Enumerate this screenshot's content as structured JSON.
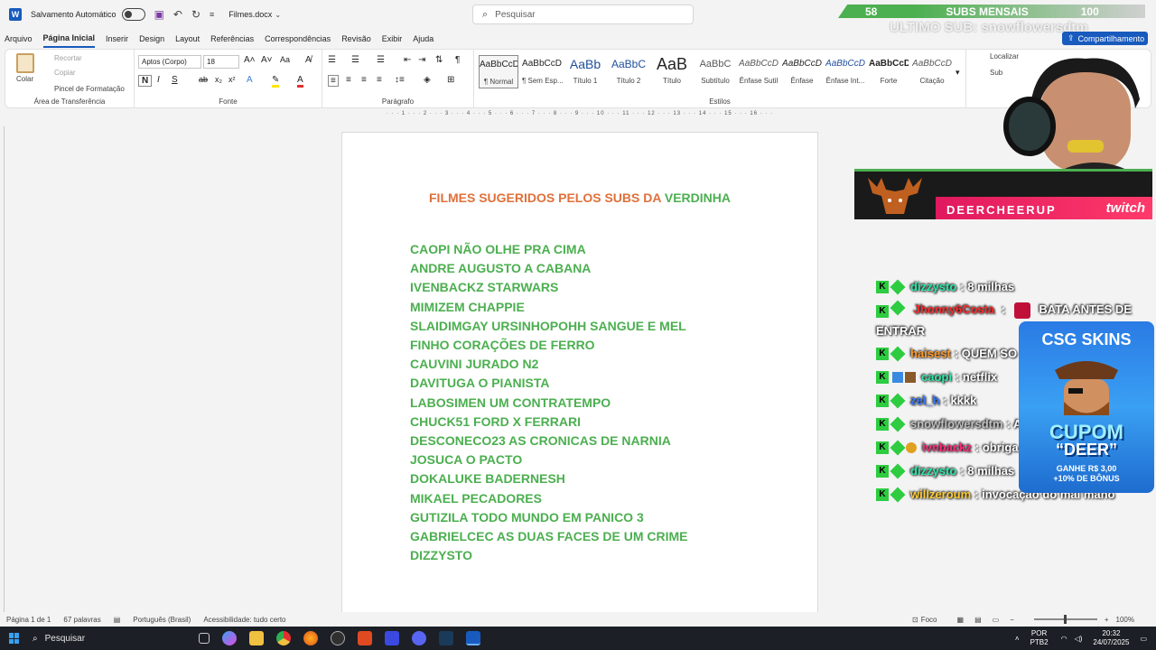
{
  "titlebar": {
    "autosave_label": "Salvamento Automático",
    "filename": "Filmes.docx",
    "search_placeholder": "Pesquisar"
  },
  "menu": {
    "tabs": [
      "Arquivo",
      "Página Inicial",
      "Inserir",
      "Design",
      "Layout",
      "Referências",
      "Correspondências",
      "Revisão",
      "Exibir",
      "Ajuda"
    ],
    "active_tab": "Página Inicial",
    "share_label": "Compartilhamento"
  },
  "ribbon": {
    "clipboard": {
      "paste": "Colar",
      "cut": "Recortar",
      "copy": "Copiar",
      "format_painter": "Pincel de Formatação",
      "group_label": "Área de Transferência"
    },
    "font": {
      "font_name": "Aptos (Corpo)",
      "font_size": "18",
      "group_label": "Fonte"
    },
    "paragraph": {
      "group_label": "Parágrafo"
    },
    "styles": {
      "group_label": "Estilos",
      "items": [
        {
          "sample": "AaBbCcD",
          "name": "¶ Normal"
        },
        {
          "sample": "AaBbCcD",
          "name": "¶ Sem Esp..."
        },
        {
          "sample": "AaBb",
          "name": "Título 1"
        },
        {
          "sample": "AaBbC",
          "name": "Título 2"
        },
        {
          "sample": "AaB",
          "name": "Título"
        },
        {
          "sample": "AaBbC",
          "name": "Subtítulo"
        },
        {
          "sample": "AaBbCcD",
          "name": "Ênfase Sutil"
        },
        {
          "sample": "AaBbCcD",
          "name": "Ênfase"
        },
        {
          "sample": "AaBbCcD",
          "name": "Ênfase Int..."
        },
        {
          "sample": "AaBbCcD",
          "name": "Forte"
        },
        {
          "sample": "AaBbCcD",
          "name": "Citação"
        }
      ]
    },
    "editing": {
      "find": "Localizar",
      "replace": "Sub"
    }
  },
  "document": {
    "title_orange": "FILMES SUGERIDOS PELOS SUBS DA ",
    "title_green": "VERDINHA",
    "movies": [
      "CAOPI NÃO OLHE PRA CIMA",
      "ANDRE AUGUSTO A CABANA",
      "IVENBACKZ STARWARS",
      "MIMIZEM CHAPPIE",
      "SLAIDIMGAY URSINHOPOHH SANGUE E MEL",
      "FINHO CORAÇÕES DE FERRO",
      "CAUVINI JURADO N2",
      "DAVITUGA O PIANISTA",
      "LABOSIMEN UM CONTRATEMPO",
      "CHUCK51 FORD X FERRARI",
      "DESCONECO23 AS CRONICAS DE NARNIA",
      "JOSUCA O PACTO",
      "DOKALUKE BADERNESH",
      "MIKAEL PECADORES",
      "GUTIZILA TODO MUNDO EM PANICO 3",
      "GABRIELCEC AS DUAS FACES DE UM CRIME",
      "DIZZYSTO"
    ]
  },
  "statusbar": {
    "page": "Página 1 de 1",
    "words": "67 palavras",
    "language": "Português (Brasil)",
    "accessibility": "Acessibilidade: tudo certo",
    "focus": "Foco",
    "zoom": "100%"
  },
  "taskbar": {
    "search_placeholder": "Pesquisar",
    "lang_top": "POR",
    "lang_bottom": "PTB2",
    "time": "20:32",
    "date": "24/07/2025"
  },
  "overlay": {
    "subs_current": "58",
    "subs_label": "SUBS MENSAIS",
    "subs_goal": "100",
    "last_sub": "ULTIMO SUB: snowflowersdtm",
    "cheer_name": "DEERCHEERUP",
    "platform": "twitch",
    "chat": [
      {
        "user": "dizzysto",
        "color": "#2ee6a6",
        "msg": ": 8 milhas"
      },
      {
        "user": "Jhonny6Costa",
        "color": "#ff2a2a",
        "msg": "BATA ANTES DE ENTRAR"
      },
      {
        "user": "haisest",
        "color": "#ff9a2a",
        "msg": ": QUEM SO"
      },
      {
        "user": "caopi",
        "color": "#2ee6a6",
        "msg": ": netflix"
      },
      {
        "user": "zel_h",
        "color": "#3a7bff",
        "msg": ": kkkk"
      },
      {
        "user": "snowflowersdtm",
        "color": "#bfbfbf",
        "msg": ": A"
      },
      {
        "user": "ivnbackz",
        "color": "#ff2a7a",
        "msg": ": obriga"
      },
      {
        "user": "dizzysto",
        "color": "#2ee6a6",
        "msg": ": 8 milhas"
      },
      {
        "user": "willzeroum",
        "color": "#ffcc33",
        "msg": ": invocação do mal mano"
      }
    ],
    "ad_brand": "CSG SKINS",
    "ad_cupom": "CUPOM",
    "ad_code": "“DEER”",
    "ad_bonus_1": "GANHE R$ 3,00",
    "ad_bonus_2": "+10% DE BÔNUS"
  }
}
